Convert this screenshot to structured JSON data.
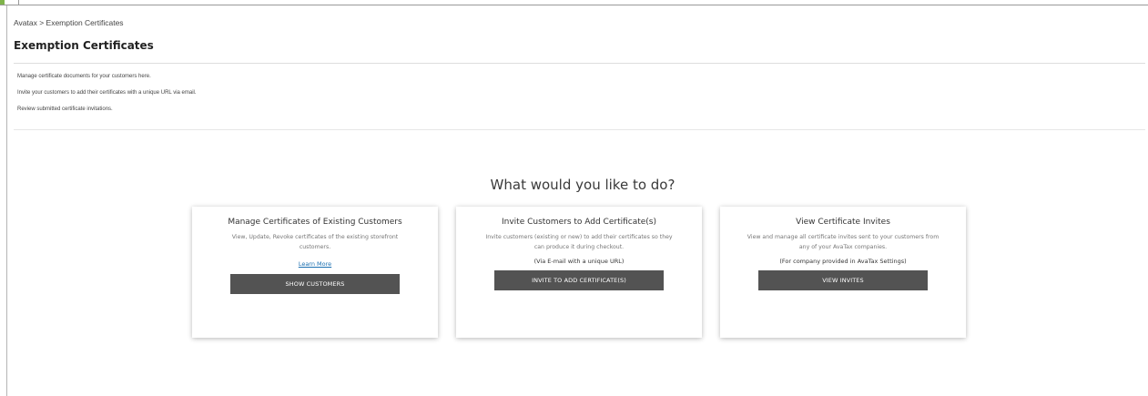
{
  "breadcrumb": "Avatax > Exemption Certificates",
  "page_title": "Exemption Certificates",
  "intro_lines": [
    "Manage certificate documents for your customers here.",
    "Invite your customers to add their certificates with a unique URL via email.",
    "Review submitted certificate invitations."
  ],
  "question": "What would you like to do?",
  "cards": [
    {
      "title": "Manage Certificates of Existing Customers",
      "description": "View, Update, Revoke certificates of the existing storefront customers.",
      "link": "Learn More",
      "button": "SHOW CUSTOMERS"
    },
    {
      "title": "Invite Customers to Add Certificate(s)",
      "description": "Invite customers (existing or new) to add their certificates so they can produce it during checkout.",
      "note": "(Via E-mail with a unique URL)",
      "button": "INVITE TO ADD CERTIFICATE(S)"
    },
    {
      "title": "View Certificate Invites",
      "description": "View and manage all certificate invites sent to your customers from any of your AvaTax companies.",
      "note": "(For company provided in AvaTax Settings)",
      "button": "VIEW INVITES"
    }
  ],
  "colors": {
    "button_bg": "#535353",
    "link": "#1a6fb0",
    "accent_green": "#7fb34a"
  }
}
